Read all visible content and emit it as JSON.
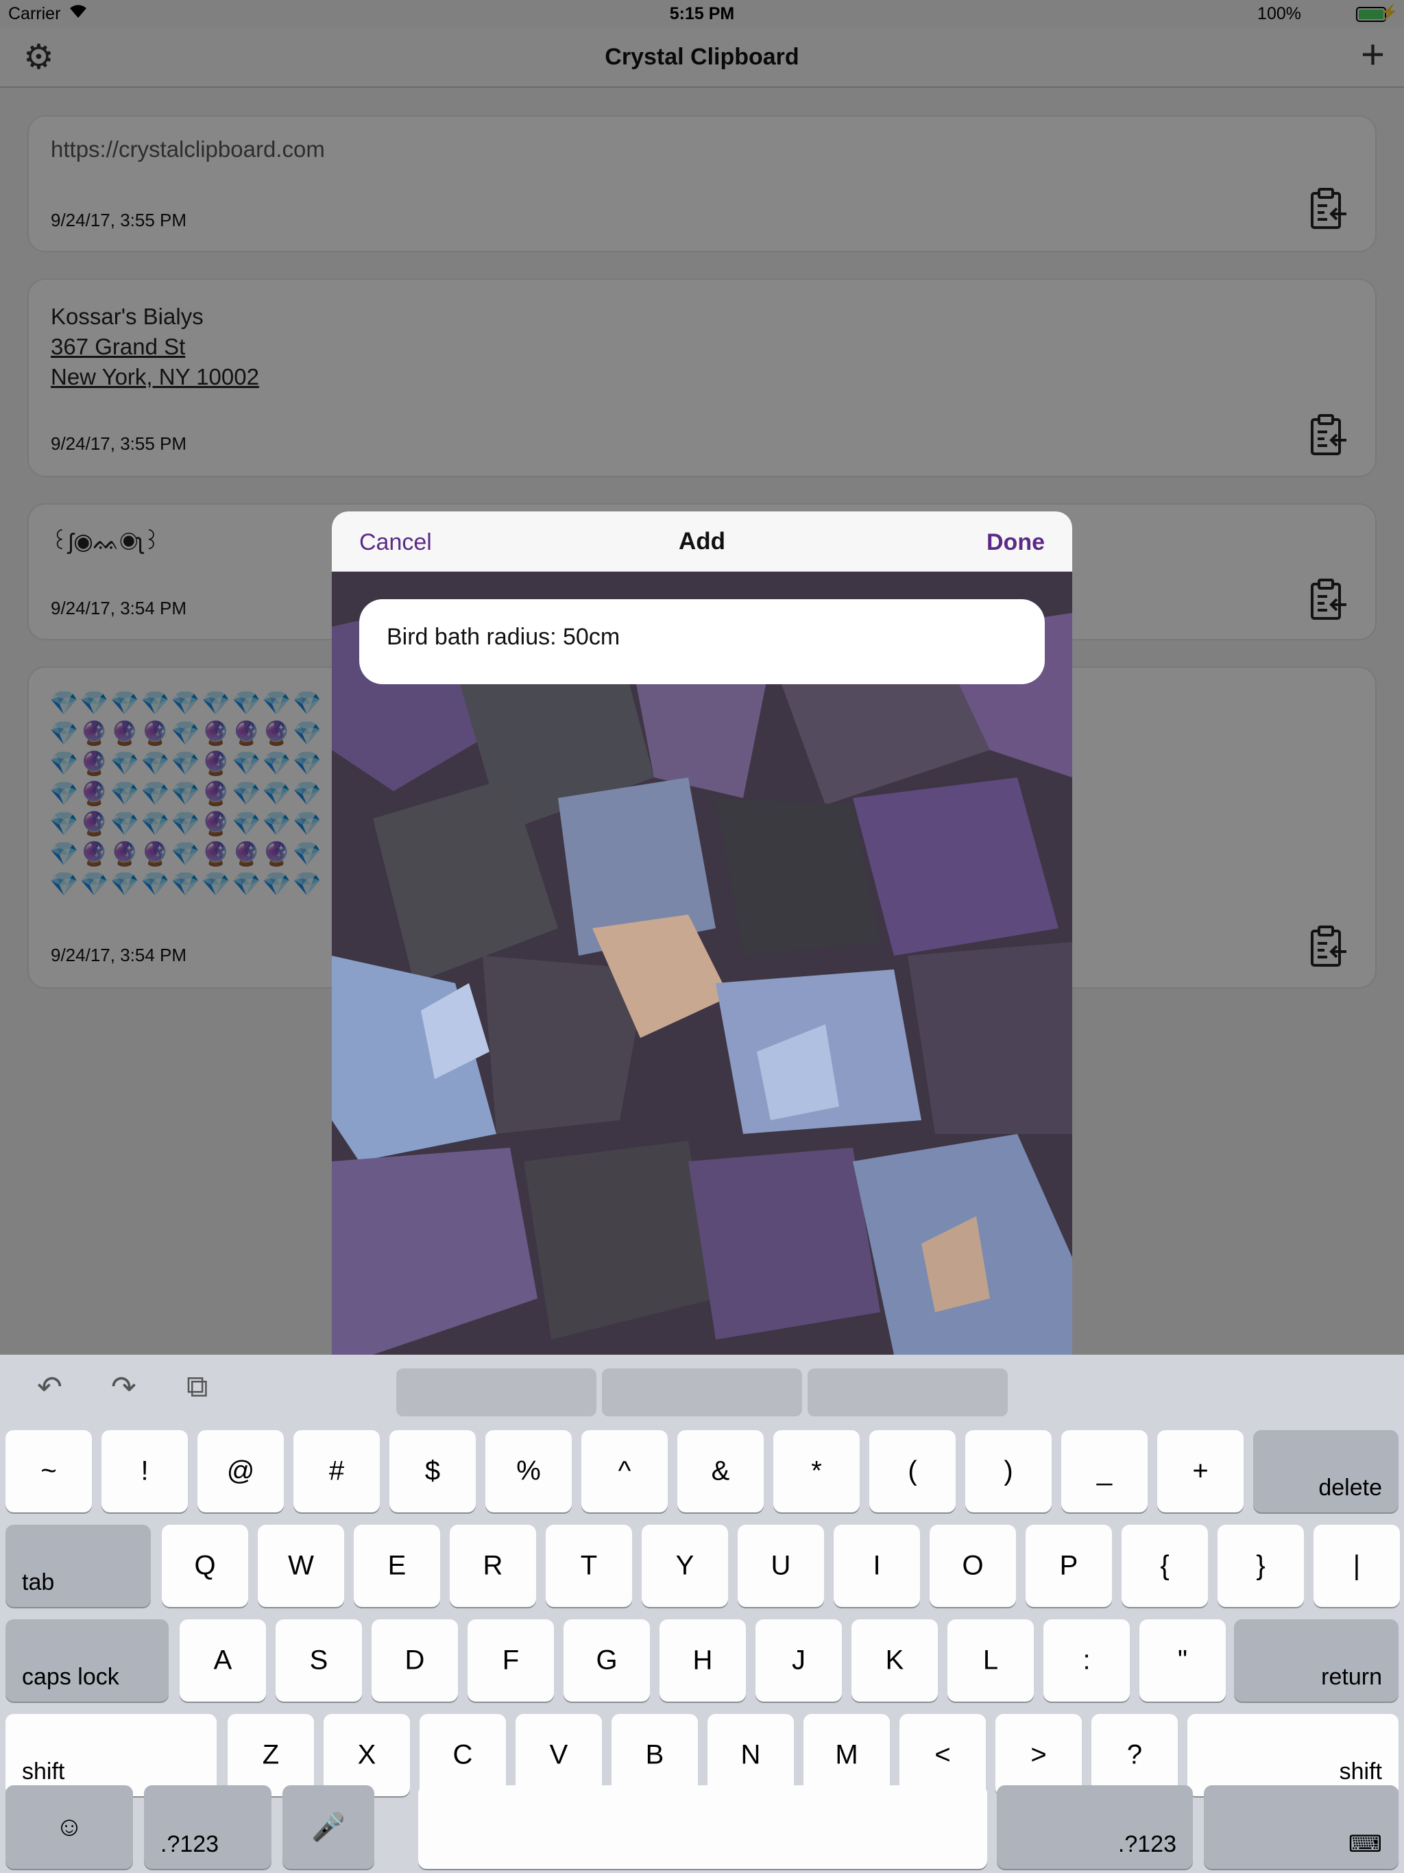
{
  "status": {
    "carrier": "Carrier",
    "time": "5:15 PM",
    "battery": "100%"
  },
  "nav": {
    "title": "Crystal Clipboard"
  },
  "clips": [
    {
      "text": "https://crystalclipboard.com",
      "date": "9/24/17, 3:55 PM"
    },
    {
      "line1": "Kossar's Bialys",
      "line2": "367 Grand St",
      "line3": "New York, NY 10002",
      "date": "9/24/17, 3:55 PM"
    },
    {
      "text": "꒰ʃ◉ᨐ◉ʅ꒱",
      "date": "9/24/17, 3:54 PM"
    },
    {
      "emoji_rows": [
        "💎💎💎💎💎💎💎💎💎",
        "💎🔮🔮🔮💎🔮🔮🔮💎",
        "💎🔮💎💎💎🔮💎💎💎",
        "💎🔮💎💎💎🔮💎💎💎",
        "💎🔮💎💎💎🔮💎💎💎",
        "💎🔮🔮🔮💎🔮🔮🔮💎",
        "💎💎💎💎💎💎💎💎💎"
      ],
      "date": "9/24/17, 3:54 PM"
    }
  ],
  "modal": {
    "cancel": "Cancel",
    "title": "Add",
    "done": "Done",
    "input_value": "Bird bath radius: 50cm"
  },
  "keyboard": {
    "row1": [
      "~",
      "!",
      "@",
      "#",
      "$",
      "%",
      "^",
      "&",
      "*",
      "(",
      ")",
      "_",
      "+"
    ],
    "delete": "delete",
    "tab": "tab",
    "row2": [
      "Q",
      "W",
      "E",
      "R",
      "T",
      "Y",
      "U",
      "I",
      "O",
      "P",
      "{",
      "}",
      "|"
    ],
    "caps": "caps lock",
    "row3": [
      "A",
      "S",
      "D",
      "F",
      "G",
      "H",
      "J",
      "K",
      "L",
      ":",
      "\""
    ],
    "return": "return",
    "shift": "shift",
    "row4": [
      "Z",
      "X",
      "C",
      "V",
      "B",
      "N",
      "M",
      "<",
      ">",
      "?"
    ],
    "numbers": ".?123"
  },
  "colors": {
    "accent": "#5b2a86"
  }
}
